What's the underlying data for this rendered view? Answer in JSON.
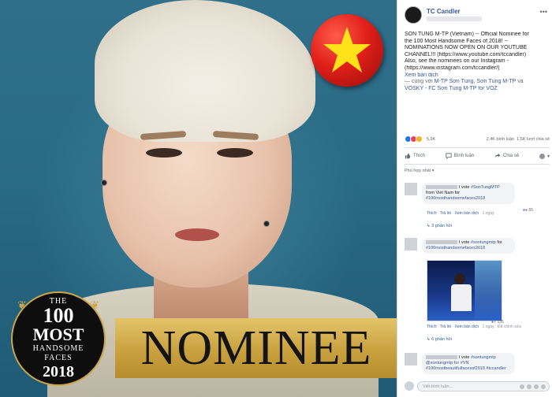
{
  "image": {
    "badge": {
      "line1": "THE",
      "line2": "100",
      "line3": "MOST",
      "line4": "HANDSOME",
      "line5": "FACES",
      "line6": "2018"
    },
    "nominee_text": "NOMINEE"
  },
  "post": {
    "page_name": "TC Candler",
    "text_lines": [
      "SON TUNG M-TP (Vietnam) -- Official Nominee for",
      "the 100 Most Handsome Faces of 2018! --",
      "NOMINATIONS NOW OPEN ON OUR YOUTUBE",
      "CHANNEL!!! (https://www.youtube.com/tccandler)",
      "Also, see the nominees on our Instagram -",
      "(https://www.instagram.com/tccandler/)"
    ],
    "see_translation": "Xem bản dịch",
    "with_prefix": "— cùng với ",
    "with_names_1": "M-TP Sơn Tùng",
    "with_sep_1": ", ",
    "with_names_2": "Sơn Tùng M-TP",
    "with_and": " và",
    "with_names_3": "VOSKY - FC Sơn Tùng M-TP for VOZ",
    "reaction_count": "5,9K",
    "comments_count": "2,4K bình luận",
    "shares_count": "1,5K lượt chia sẻ",
    "actions": {
      "like": "Thích",
      "comment": "Bình luận",
      "share": "Chia sẻ"
    },
    "sort_label": "Phù hợp nhất ▾"
  },
  "comments": [
    {
      "text_a": "I vote ",
      "tag_a": "#SonTungMTP",
      "text_b": " from Viet Nam for ",
      "tag_b": "#100mosthandsomefaces2018",
      "meta_like": "Thích",
      "meta_reply": "Trả lời",
      "meta_translate": "Xem bản dịch",
      "meta_time": "1 ngày",
      "reactions": "55",
      "replies": "↳ 3 phản hồi"
    },
    {
      "text_a": "I vote ",
      "tag_a": "#sontungmtp",
      "text_b": " for ",
      "tag_b": "#100mosthandsomefaces2018",
      "meta_like": "Thích",
      "meta_reply": "Trả lời",
      "meta_translate": "Xem bản dịch",
      "meta_time": "1 ngày",
      "meta_edited": "Đã chỉnh sửa",
      "reactions": "135",
      "replies": "↳ 6 phản hồi"
    },
    {
      "text_a": "I vote ",
      "tag_a": "#sontungmtp",
      "text_b": " ",
      "tag_b": "@sontungmtp for #VN",
      "tag_c": "#100mostbeautifulfacesof2018",
      "tag_d": " #tccandler"
    }
  ],
  "write_comment": {
    "placeholder": "Viết bình luận..."
  }
}
